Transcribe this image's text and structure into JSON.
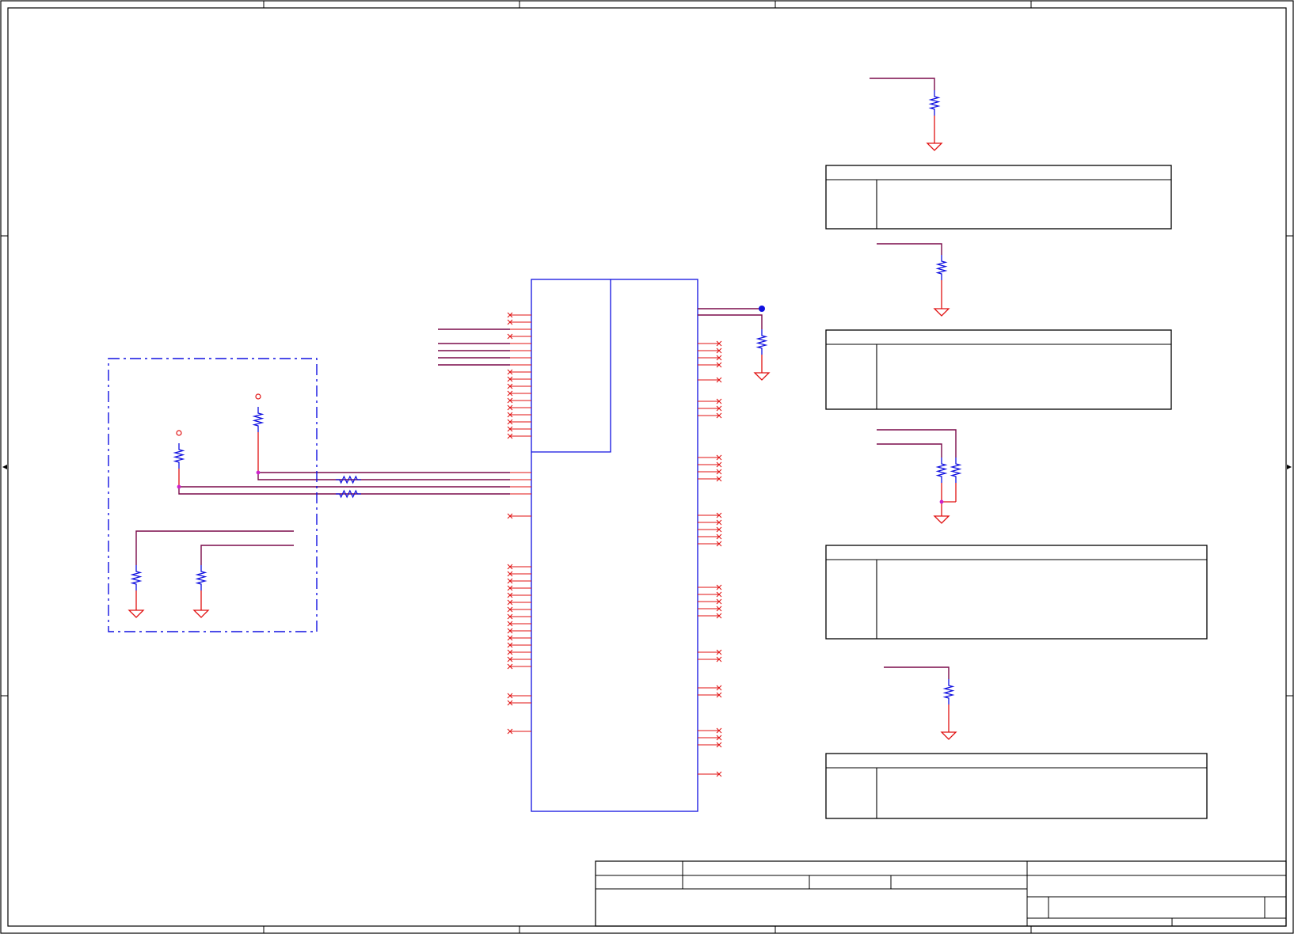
{
  "sheet": {
    "title_block_fields": []
  },
  "colors": {
    "frame": "#000000",
    "wire": "#7a0a4a",
    "pin": "#e01010",
    "component": "#1010e0",
    "junction": "#cc22cc",
    "ground": "#e01010",
    "dashed_box": "#1010e0"
  },
  "symbols": {
    "resistor": "resistor-icon",
    "ground": "ground-icon",
    "power_port": "power-port-icon",
    "no_connect": "no-connect-icon",
    "junction": "junction-icon"
  }
}
